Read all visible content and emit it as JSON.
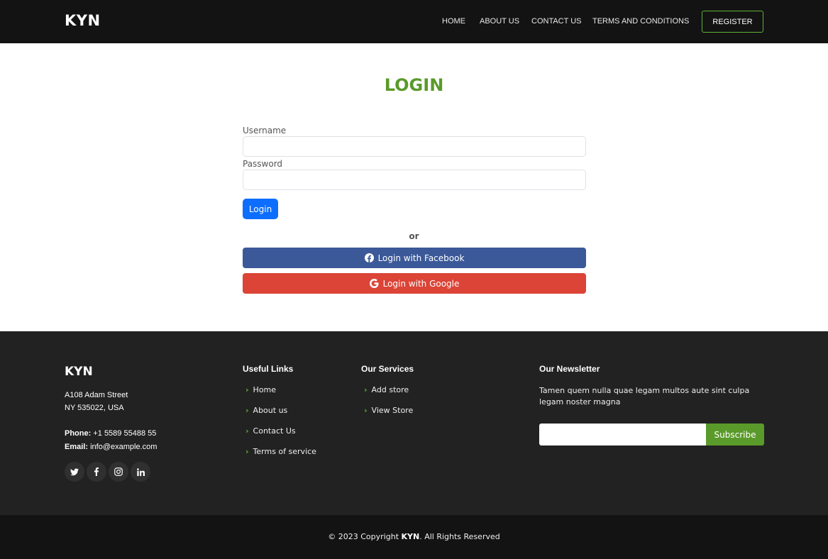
{
  "header": {
    "logo": "KYN",
    "nav": [
      {
        "label": "HOME"
      },
      {
        "label": "ABOUT US"
      },
      {
        "label": "CONTACT US"
      },
      {
        "label": "TERMS AND CONDITIONS"
      }
    ],
    "register_label": "REGISTER"
  },
  "login": {
    "title": "LOGIN",
    "username_label": "Username",
    "username_value": "",
    "password_label": "Password",
    "password_value": "",
    "login_button": "Login",
    "or_text": "or",
    "facebook_button": "Login with Facebook",
    "google_button": "Login with Google"
  },
  "footer": {
    "logo": "KYN",
    "address_line1": "A108 Adam Street",
    "address_line2": "NY 535022, USA",
    "phone_label": "Phone:",
    "phone_value": "+1 5589 55488 55",
    "email_label": "Email:",
    "email_value": "info@example.com",
    "social": [
      "twitter-icon",
      "facebook-icon",
      "instagram-icon",
      "linkedin-icon"
    ],
    "useful_links": {
      "heading": "Useful Links",
      "items": [
        "Home",
        "About us",
        "Contact Us",
        "Terms of service"
      ]
    },
    "services": {
      "heading": "Our Services",
      "items": [
        "Add store",
        "View Store"
      ]
    },
    "newsletter": {
      "heading": "Our Newsletter",
      "text": "Tamen quem nulla quae legam multos aute sint culpa legam noster magna",
      "input_value": "",
      "subscribe_label": "Subscribe"
    },
    "copyright_prefix": "© 2023 Copyright ",
    "copyright_brand": "KYN",
    "copyright_suffix": ". All Rights Reserved"
  },
  "colors": {
    "header_bg": "#131313",
    "footer_bg": "#222222",
    "accent_green": "#5a9a2a",
    "primary_blue": "#0d6efd",
    "facebook_blue": "#3b5998",
    "google_red": "#db4437"
  }
}
